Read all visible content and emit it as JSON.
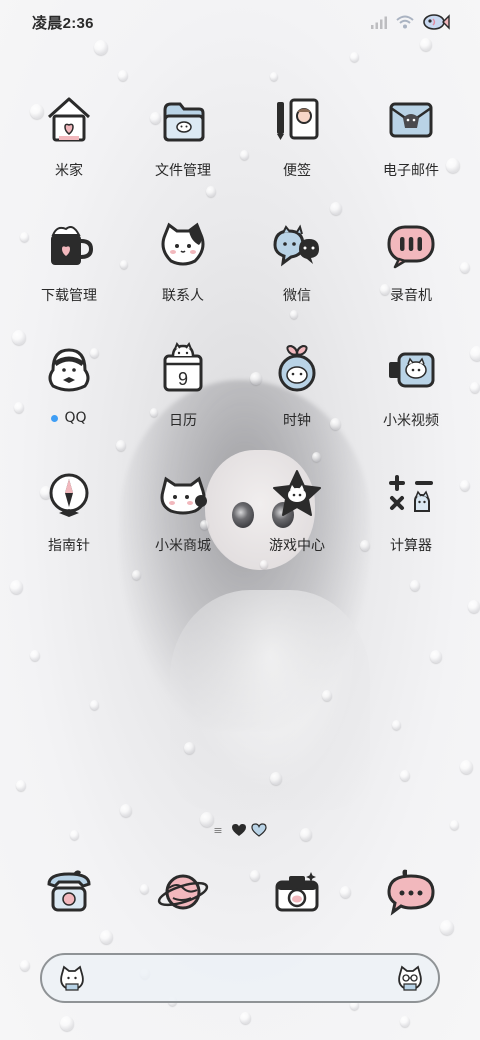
{
  "status_bar": {
    "time": "凌晨2:36",
    "icons": [
      "signal-icon",
      "wifi-icon",
      "fish-icon"
    ]
  },
  "apps": [
    {
      "label": "米家",
      "icon": "house-icon"
    },
    {
      "label": "文件管理",
      "icon": "folder-icon"
    },
    {
      "label": "便签",
      "icon": "notebook-pencil-icon"
    },
    {
      "label": "电子邮件",
      "icon": "envelope-icon"
    },
    {
      "label": "下载管理",
      "icon": "mug-download-icon"
    },
    {
      "label": "联系人",
      "icon": "cat-contact-icon"
    },
    {
      "label": "微信",
      "icon": "chat-bubbles-icon"
    },
    {
      "label": "录音机",
      "icon": "recorder-bubble-icon"
    },
    {
      "label": "QQ",
      "icon": "penguin-icon",
      "notification_dot": true
    },
    {
      "label": "日历",
      "icon": "calendar-icon",
      "day": "9"
    },
    {
      "label": "时钟",
      "icon": "alarm-clock-icon"
    },
    {
      "label": "小米视频",
      "icon": "video-camera-icon"
    },
    {
      "label": "指南针",
      "icon": "compass-icon"
    },
    {
      "label": "小米商城",
      "icon": "cat-shop-icon"
    },
    {
      "label": "游戏中心",
      "icon": "star-game-icon"
    },
    {
      "label": "计算器",
      "icon": "calculator-icon"
    }
  ],
  "page_indicator": {
    "lines": "≡",
    "pages": 2,
    "current": 1
  },
  "dock": [
    {
      "icon": "telephone-icon"
    },
    {
      "icon": "planet-browser-icon"
    },
    {
      "icon": "camera-icon"
    },
    {
      "icon": "message-bubble-icon"
    }
  ],
  "search_bar": {
    "left_icon": "mascot-cat-icon",
    "right_icon": "mascot-glasses-icon"
  },
  "colors": {
    "accent_dot": "#3f9ef5",
    "icon_outline": "#2b2b2b",
    "pink": "#f2b8bd",
    "blue": "#b9d3e6"
  }
}
